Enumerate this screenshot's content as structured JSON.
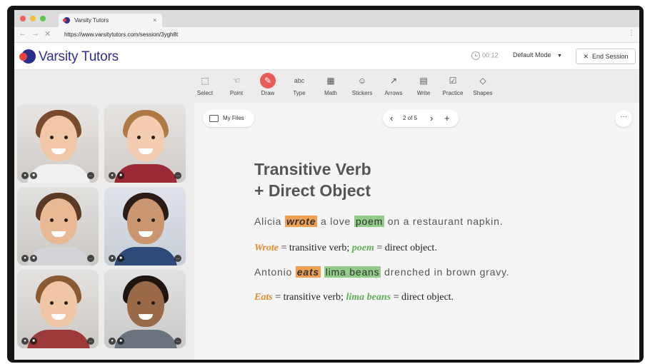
{
  "browser": {
    "tab_title": "Varsity Tutors",
    "tab_close": "×",
    "url": "https://www.varsitytutors.com/session/3ygh8t",
    "back": "←",
    "forward": "→",
    "stop": "✕",
    "menu": "⋮"
  },
  "app": {
    "brand": "Varsity Tutors",
    "timer": "00:12",
    "mode_label": "Default Mode",
    "end_session": "End Session"
  },
  "toolbar": {
    "tools": [
      {
        "label": "Select",
        "icon": "⬚"
      },
      {
        "label": "Point",
        "icon": "☜"
      },
      {
        "label": "Draw",
        "icon": "✎"
      },
      {
        "label": "Type",
        "icon": "abc"
      },
      {
        "label": "Math",
        "icon": "▦"
      },
      {
        "label": "Stickers",
        "icon": "☺"
      },
      {
        "label": "Arrows",
        "icon": "↗"
      },
      {
        "label": "Write",
        "icon": "▤"
      },
      {
        "label": "Practice",
        "icon": "☑"
      },
      {
        "label": "Shapes",
        "icon": "◇"
      }
    ],
    "active_tool": "Draw"
  },
  "board": {
    "my_files": "My Files",
    "page_indicator": "2 of 5",
    "prev": "‹",
    "next": "›",
    "add": "+",
    "more": "···",
    "title_line1": "Transitive Verb",
    "title_line2": "+ Direct Object",
    "sentence1": {
      "pre": "Alicia ",
      "verb": "wrote",
      "mid": " a love ",
      "obj": "poem",
      "post": " on a restaurant napkin."
    },
    "expl1": {
      "verb": "Wrote",
      "mid": " = transitive verb; ",
      "obj": "poem",
      "post": " = direct object."
    },
    "sentence2": {
      "pre": "Antonio ",
      "verb": "eats",
      "mid": " ",
      "obj": "lima beans",
      "post": " drenched in brown gravy."
    },
    "expl2": {
      "verb": "Eats",
      "mid": " = transitive verb; ",
      "obj": "lima beans",
      "post": " = direct object."
    }
  },
  "colors": {
    "brand": "#2d3192",
    "accent_red": "#e85b5b",
    "verb_highlight": "#f0a054",
    "object_highlight": "#93cc8a"
  }
}
